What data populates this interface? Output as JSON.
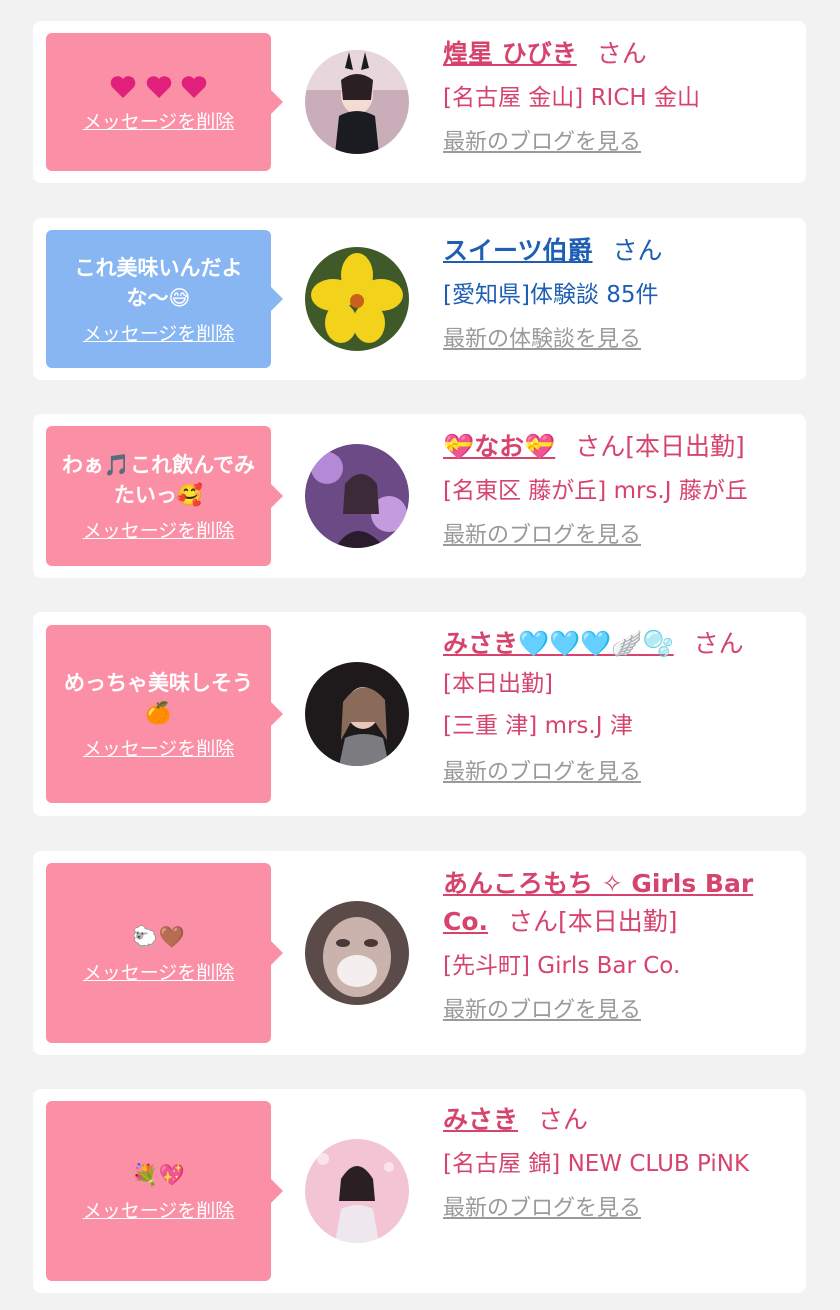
{
  "colors": {
    "pink_bubble": "#fb8fa6",
    "blue_bubble": "#88b6f2",
    "pink_text": "#d6446d",
    "blue_text": "#1e5eb3",
    "gray_link": "#9a9a9a"
  },
  "items": [
    {
      "msg_text": "",
      "msg_icons": [
        "heart-icon",
        "heart-icon",
        "heart-icon"
      ],
      "delete_label": "メッセージを削除",
      "name": "煌星 ひびき",
      "name_icons": [],
      "suffix": "さん",
      "sub_lines": [
        "[名古屋 金山] RICH 金山"
      ],
      "link": "最新のブログを見る",
      "avatar_icon": "bunny-girl-photo-icon"
    },
    {
      "msg_text": "これ美味いんだよな〜😅",
      "msg_icons": [],
      "delete_label": "メッセージを削除",
      "name": "スイーツ伯爵",
      "name_icons": [],
      "suffix": "さん",
      "sub_lines": [
        "[愛知県]体験談 85件"
      ],
      "link": "最新の体験談を見る",
      "avatar_icon": "yellow-flower-icon"
    },
    {
      "msg_text": "わぁ🎵これ飲んでみたいっ🥰",
      "msg_icons": [],
      "delete_label": "メッセージを削除",
      "name": "💝なお💝",
      "name_icons": [],
      "suffix": "さん[本日出勤]",
      "sub_lines": [
        "[名東区 藤が丘] mrs.J 藤が丘"
      ],
      "link": "最新のブログを見る",
      "avatar_icon": "purple-floral-photo-icon"
    },
    {
      "msg_text": "めっちゃ美味しそう🍊",
      "msg_icons": [],
      "delete_label": "メッセージを削除",
      "name": "みさき🩵🩵🩵🪽🫧",
      "name_icons": [],
      "suffix": "さん",
      "sub_lines": [
        "[本日出勤]",
        "[三重 津] mrs.J 津"
      ],
      "link": "最新のブログを見る",
      "avatar_icon": "woman-photo-icon"
    },
    {
      "msg_text": "🐑🤎",
      "msg_icons": [],
      "delete_label": "メッセージを削除",
      "name": "あんころもち ✧ Girls Bar Co.",
      "name_icons": [],
      "suffix": "さん[本日出勤]",
      "sub_lines": [
        "[先斗町] Girls Bar Co."
      ],
      "link": "最新のブログを見る",
      "avatar_icon": "blurred-face-photo-icon"
    },
    {
      "msg_text": "💐💖",
      "msg_icons": [],
      "delete_label": "メッセージを削除",
      "name": "みさき",
      "name_icons": [],
      "suffix": "さん",
      "sub_lines": [
        "[名古屋 錦] NEW CLUB PiNK"
      ],
      "link": "最新のブログを見る",
      "avatar_icon": "pink-portrait-photo-icon"
    }
  ]
}
